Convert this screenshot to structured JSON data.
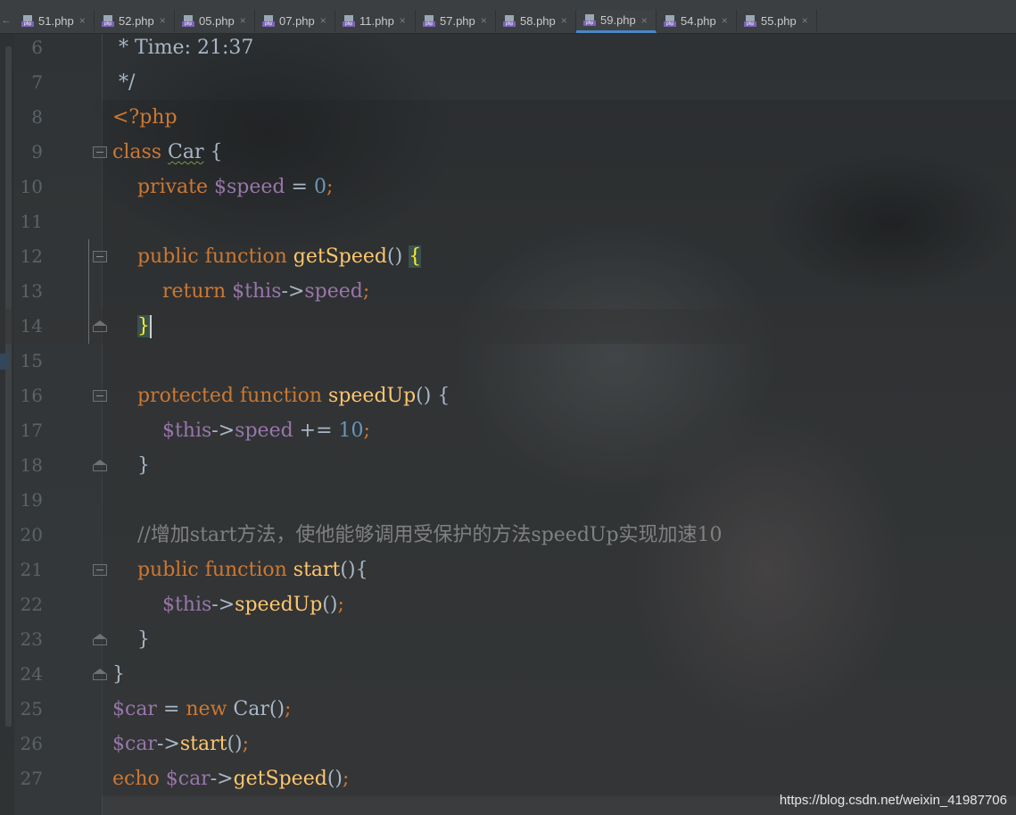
{
  "tabs": [
    {
      "label": "51.php",
      "active": false
    },
    {
      "label": "52.php",
      "active": false
    },
    {
      "label": "05.php",
      "active": false
    },
    {
      "label": "07.php",
      "active": false
    },
    {
      "label": "11.php",
      "active": false
    },
    {
      "label": "57.php",
      "active": false
    },
    {
      "label": "58.php",
      "active": false
    },
    {
      "label": "59.php",
      "active": true
    },
    {
      "label": "54.php",
      "active": false
    },
    {
      "label": "55.php",
      "active": false
    }
  ],
  "tab_close_glyph": "×",
  "tab_nav_glyph": "←",
  "file_icon_text": "php",
  "lines": [
    {
      "n": "6",
      "tokens": [
        {
          "t": " * Time: 21:37",
          "c": "plain"
        }
      ]
    },
    {
      "n": "7",
      "tokens": [
        {
          "t": " */",
          "c": "plain"
        }
      ]
    },
    {
      "n": "8",
      "tokens": [
        {
          "t": "<?php",
          "c": "tag"
        }
      ]
    },
    {
      "n": "9",
      "tokens": [
        {
          "t": "class ",
          "c": "kw"
        },
        {
          "t": "Car",
          "c": "cls"
        },
        {
          "t": " {",
          "c": "plain"
        }
      ]
    },
    {
      "n": "10",
      "tokens": [
        {
          "t": "    private ",
          "c": "kw"
        },
        {
          "t": "$speed",
          "c": "var"
        },
        {
          "t": " = ",
          "c": "plain"
        },
        {
          "t": "0",
          "c": "num"
        },
        {
          "t": ";",
          "c": "kw"
        }
      ]
    },
    {
      "n": "11",
      "tokens": []
    },
    {
      "n": "12",
      "tokens": [
        {
          "t": "    public ",
          "c": "kw"
        },
        {
          "t": "function ",
          "c": "kw"
        },
        {
          "t": "getSpeed",
          "c": "fn"
        },
        {
          "t": "() ",
          "c": "plain"
        },
        {
          "t": "{",
          "c": "brace-hl"
        }
      ]
    },
    {
      "n": "13",
      "tokens": [
        {
          "t": "        return ",
          "c": "kw"
        },
        {
          "t": "$this",
          "c": "var"
        },
        {
          "t": "->",
          "c": "plain"
        },
        {
          "t": "speed",
          "c": "var"
        },
        {
          "t": ";",
          "c": "kw"
        }
      ]
    },
    {
      "n": "14",
      "tokens": [
        {
          "t": "    ",
          "c": "plain"
        },
        {
          "t": "}",
          "c": "brace-hl"
        }
      ]
    },
    {
      "n": "15",
      "tokens": []
    },
    {
      "n": "16",
      "tokens": [
        {
          "t": "    protected ",
          "c": "kw"
        },
        {
          "t": "function ",
          "c": "kw"
        },
        {
          "t": "speedUp",
          "c": "fn"
        },
        {
          "t": "() {",
          "c": "plain"
        }
      ]
    },
    {
      "n": "17",
      "tokens": [
        {
          "t": "        ",
          "c": "plain"
        },
        {
          "t": "$this",
          "c": "var"
        },
        {
          "t": "->",
          "c": "plain"
        },
        {
          "t": "speed",
          "c": "var"
        },
        {
          "t": " += ",
          "c": "plain"
        },
        {
          "t": "10",
          "c": "num"
        },
        {
          "t": ";",
          "c": "kw"
        }
      ]
    },
    {
      "n": "18",
      "tokens": [
        {
          "t": "    }",
          "c": "plain"
        }
      ]
    },
    {
      "n": "19",
      "tokens": []
    },
    {
      "n": "20",
      "tokens": [
        {
          "t": "    //增加start方法，使他能够调用受保护的方法speedUp实现加速10",
          "c": "cmt"
        }
      ]
    },
    {
      "n": "21",
      "tokens": [
        {
          "t": "    public ",
          "c": "kw"
        },
        {
          "t": "function ",
          "c": "kw"
        },
        {
          "t": "start",
          "c": "fn"
        },
        {
          "t": "(){",
          "c": "plain"
        }
      ]
    },
    {
      "n": "22",
      "tokens": [
        {
          "t": "        ",
          "c": "plain"
        },
        {
          "t": "$this",
          "c": "var"
        },
        {
          "t": "->",
          "c": "plain"
        },
        {
          "t": "speedUp",
          "c": "fn"
        },
        {
          "t": "()",
          "c": "plain"
        },
        {
          "t": ";",
          "c": "kw"
        }
      ]
    },
    {
      "n": "23",
      "tokens": [
        {
          "t": "    }",
          "c": "plain"
        }
      ]
    },
    {
      "n": "24",
      "tokens": [
        {
          "t": "}",
          "c": "plain"
        }
      ]
    },
    {
      "n": "25",
      "tokens": [
        {
          "t": "$car",
          "c": "var"
        },
        {
          "t": " = ",
          "c": "plain"
        },
        {
          "t": "new ",
          "c": "kw"
        },
        {
          "t": "Car",
          "c": "plain"
        },
        {
          "t": "()",
          "c": "plain"
        },
        {
          "t": ";",
          "c": "kw"
        }
      ]
    },
    {
      "n": "26",
      "tokens": [
        {
          "t": "$car",
          "c": "var"
        },
        {
          "t": "->",
          "c": "plain"
        },
        {
          "t": "start",
          "c": "fn"
        },
        {
          "t": "()",
          "c": "plain"
        },
        {
          "t": ";",
          "c": "kw"
        }
      ]
    },
    {
      "n": "27",
      "tokens": [
        {
          "t": "echo ",
          "c": "kw"
        },
        {
          "t": "$car",
          "c": "var"
        },
        {
          "t": "->",
          "c": "plain"
        },
        {
          "t": "getSpeed",
          "c": "fn"
        },
        {
          "t": "()",
          "c": "plain"
        },
        {
          "t": ";",
          "c": "kw"
        }
      ]
    }
  ],
  "watermark": "https://blog.csdn.net/weixin_41987706",
  "colors": {
    "keyword": "#cc7832",
    "variable": "#9876aa",
    "function": "#ffc66d",
    "number": "#6897bb",
    "comment": "#808080",
    "text": "#a9b7c6",
    "active_tab_underline": "#4a88c7"
  }
}
